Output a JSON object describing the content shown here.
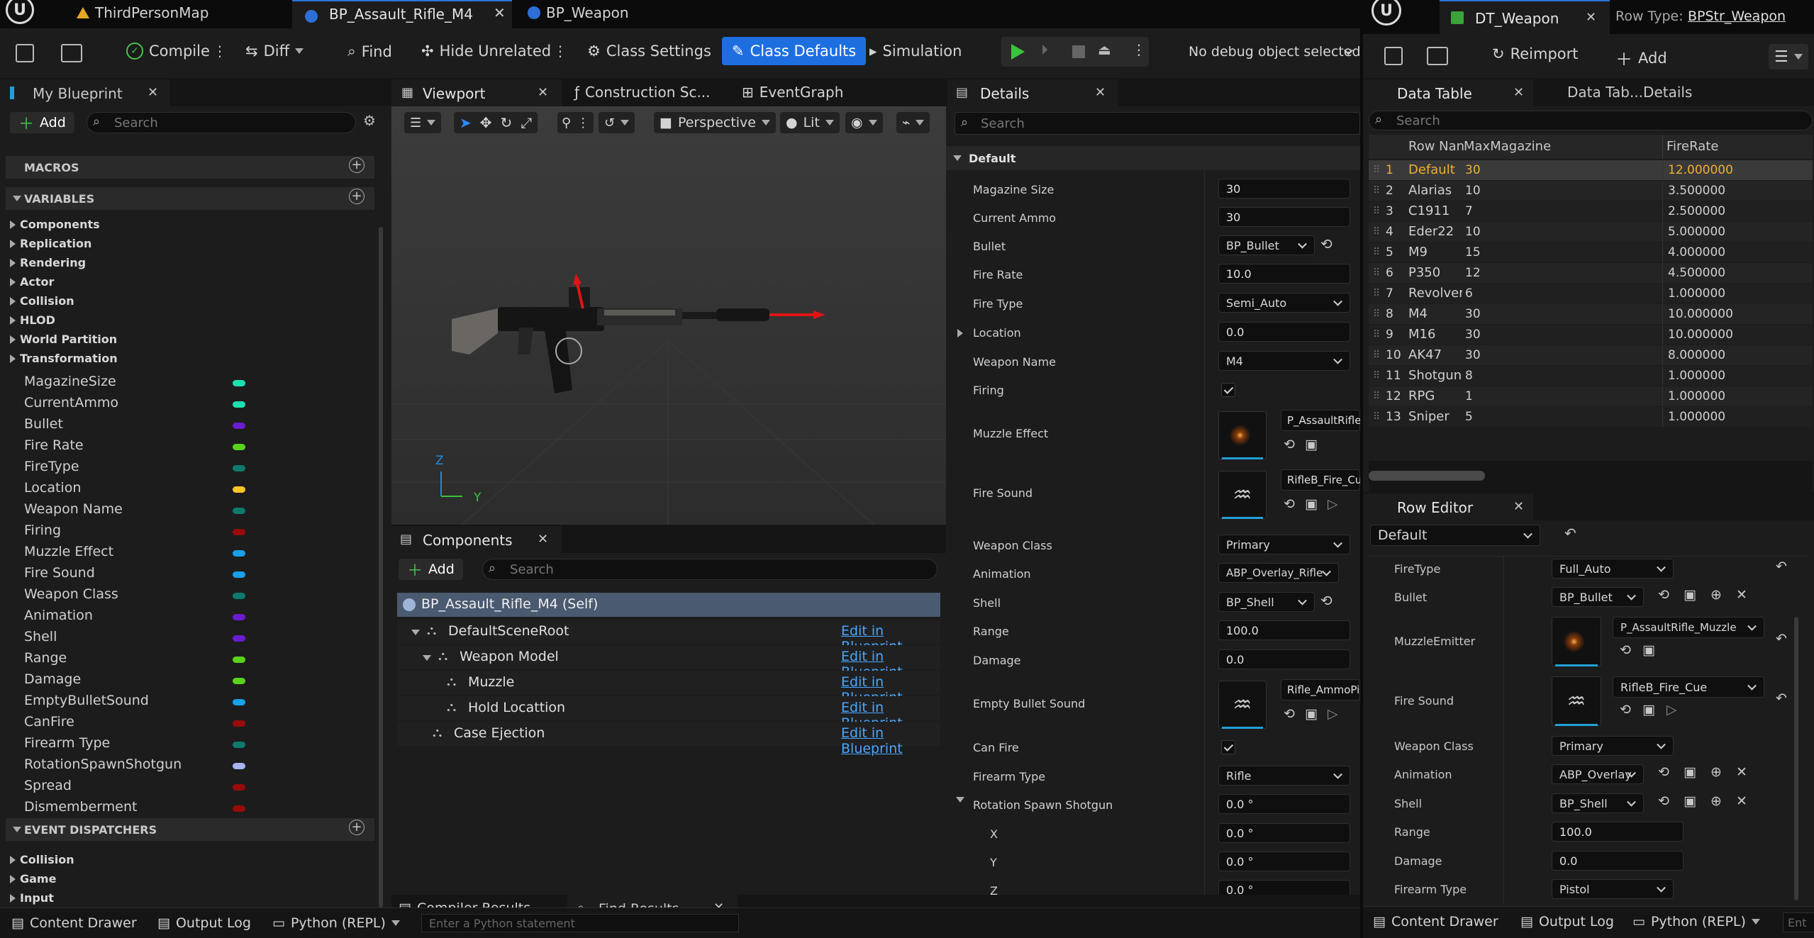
{
  "tabs": {
    "map": "ThirdPersonMap",
    "rifle": "BP_Assault_Rifle_M4",
    "weapon": "BP_Weapon",
    "dt": "DT_Weapon",
    "row_type_label": "Row Type:",
    "row_type_value": "BPStr_Weapon"
  },
  "toolbar": {
    "compile": "Compile",
    "diff": "Diff",
    "find": "Find",
    "hide_unrelated": "Hide Unrelated",
    "class_settings": "Class Settings",
    "class_defaults": "Class Defaults",
    "simulation": "Simulation",
    "debug": "No debug object selected",
    "reimport": "Reimport",
    "add": "Add"
  },
  "my_blueprint": {
    "title": "My Blueprint",
    "add": "Add",
    "search_placeholder": "Search",
    "macros": "MACROS",
    "variables": "VARIABLES",
    "categories": [
      "Components",
      "Replication",
      "Rendering",
      "Actor",
      "Collision",
      "HLOD",
      "World Partition",
      "Transformation"
    ],
    "vars": [
      {
        "name": "MagazineSize",
        "color": "#1de0b0"
      },
      {
        "name": "CurrentAmmo",
        "color": "#1de0b0"
      },
      {
        "name": "Bullet",
        "color": "#6a1cd0"
      },
      {
        "name": "Fire Rate",
        "color": "#5ad21a"
      },
      {
        "name": "FireType",
        "color": "#0d7a6c"
      },
      {
        "name": "Location",
        "color": "#f6c62a"
      },
      {
        "name": "Weapon Name",
        "color": "#0d7a6c"
      },
      {
        "name": "Firing",
        "color": "#9a0a0a"
      },
      {
        "name": "Muzzle Effect",
        "color": "#18a0e8"
      },
      {
        "name": "Fire Sound",
        "color": "#18a0e8"
      },
      {
        "name": "Weapon Class",
        "color": "#0d7a6c"
      },
      {
        "name": "Animation",
        "color": "#6a1cd0"
      },
      {
        "name": "Shell",
        "color": "#6a1cd0"
      },
      {
        "name": "Range",
        "color": "#5ad21a"
      },
      {
        "name": "Damage",
        "color": "#5ad21a"
      },
      {
        "name": "EmptyBulletSound",
        "color": "#18a0e8"
      },
      {
        "name": "CanFire",
        "color": "#9a0a0a"
      },
      {
        "name": "Firearm Type",
        "color": "#0d7a6c"
      },
      {
        "name": "RotationSpawnShotgun",
        "color": "#a8b4f0"
      },
      {
        "name": "Spread",
        "color": "#9a0a0a"
      },
      {
        "name": "Dismemberment",
        "color": "#9a0a0a"
      }
    ],
    "event_dispatchers": "EVENT DISPATCHERS",
    "ed_categories": [
      "Collision",
      "Game",
      "Input"
    ]
  },
  "viewport": {
    "tab_viewport": "Viewport",
    "tab_construction": "Construction Sc...",
    "tab_eventgraph": "EventGraph",
    "perspective": "Perspective",
    "lit": "Lit",
    "axis_z": "Z",
    "axis_y": "Y"
  },
  "components": {
    "title": "Components",
    "add": "Add",
    "search_placeholder": "Search",
    "self": "BP_Assault_Rifle_M4 (Self)",
    "edit": "Edit in Blueprint",
    "items": [
      "DefaultSceneRoot",
      "Weapon Model",
      "Muzzle",
      "Hold Locattion",
      "Case Ejection"
    ]
  },
  "details": {
    "title": "Details",
    "search_placeholder": "Search",
    "section": "Default",
    "props": {
      "magazine_size": {
        "label": "Magazine Size",
        "value": "30"
      },
      "current_ammo": {
        "label": "Current Ammo",
        "value": "30"
      },
      "bullet": {
        "label": "Bullet",
        "value": "BP_Bullet"
      },
      "fire_rate": {
        "label": "Fire Rate",
        "value": "10.0"
      },
      "fire_type": {
        "label": "Fire Type",
        "value": "Semi_Auto"
      },
      "location": {
        "label": "Location",
        "value": "0.0"
      },
      "weapon_name": {
        "label": "Weapon Name",
        "value": "M4"
      },
      "firing": {
        "label": "Firing"
      },
      "muzzle_effect": {
        "label": "Muzzle Effect",
        "value": "P_AssaultRifle"
      },
      "fire_sound": {
        "label": "Fire Sound",
        "value": "RifleB_Fire_Cu"
      },
      "weapon_class": {
        "label": "Weapon Class",
        "value": "Primary"
      },
      "animation": {
        "label": "Animation",
        "value": "ABP_Overlay_Rifle"
      },
      "shell": {
        "label": "Shell",
        "value": "BP_Shell"
      },
      "range": {
        "label": "Range",
        "value": "100.0"
      },
      "damage": {
        "label": "Damage",
        "value": "0.0"
      },
      "empty_bullet_sound": {
        "label": "Empty Bullet Sound",
        "value": "Rifle_AmmoPi"
      },
      "can_fire": {
        "label": "Can Fire"
      },
      "firearm_type": {
        "label": "Firearm Type",
        "value": "Rifle"
      },
      "rotation_spawn": {
        "label": "Rotation Spawn Shotgun",
        "value": "0.0 °"
      },
      "x": {
        "label": "X",
        "value": "0.0 °"
      },
      "y": {
        "label": "Y",
        "value": "0.0 °"
      },
      "z": {
        "label": "Z",
        "value": "0.0 °"
      }
    }
  },
  "data_table": {
    "tab1": "Data Table",
    "tab2": "Data Tab...Details",
    "search_placeholder": "Search",
    "columns": [
      "Row Nan",
      "MaxMagazine",
      "FireRate"
    ],
    "rows": [
      [
        "1",
        "Default",
        "30",
        "12.000000"
      ],
      [
        "2",
        "Alarias",
        "10",
        "3.500000"
      ],
      [
        "3",
        "C1911",
        "7",
        "2.500000"
      ],
      [
        "4",
        "Eder22",
        "10",
        "5.000000"
      ],
      [
        "5",
        "M9",
        "15",
        "4.000000"
      ],
      [
        "6",
        "P350",
        "12",
        "4.500000"
      ],
      [
        "7",
        "Revolver",
        "6",
        "1.000000"
      ],
      [
        "8",
        "M4",
        "30",
        "10.000000"
      ],
      [
        "9",
        "M16",
        "30",
        "10.000000"
      ],
      [
        "10",
        "AK47",
        "30",
        "8.000000"
      ],
      [
        "11",
        "Shotgun",
        "8",
        "1.000000"
      ],
      [
        "12",
        "RPG",
        "1",
        "1.000000"
      ],
      [
        "13",
        "Sniper",
        "5",
        "1.000000"
      ]
    ]
  },
  "row_editor": {
    "title": "Row Editor",
    "row": "Default",
    "fields": {
      "fire_type": {
        "label": "FireType",
        "value": "Full_Auto"
      },
      "bullet": {
        "label": "Bullet",
        "value": "BP_Bullet"
      },
      "muzzle": {
        "label": "MuzzleEmitter",
        "value": "P_AssaultRifle_Muzzle"
      },
      "fire_sound": {
        "label": "Fire Sound",
        "value": "RifleB_Fire_Cue"
      },
      "weapon_class": {
        "label": "Weapon Class",
        "value": "Primary"
      },
      "animation": {
        "label": "Animation",
        "value": "ABP_Overlay"
      },
      "shell": {
        "label": "Shell",
        "value": "BP_Shell"
      },
      "range": {
        "label": "Range",
        "value": "100.0"
      },
      "damage": {
        "label": "Damage",
        "value": "0.0"
      },
      "firearm_type": {
        "label": "Firearm Type",
        "value": "Pistol"
      }
    }
  },
  "bottom": {
    "content_drawer": "Content Drawer",
    "output_log": "Output Log",
    "python": "Python (REPL)",
    "cmd_placeholder": "Enter a Python statement",
    "compiler_results": "Compiler Results",
    "find_results": "Find Results",
    "ent": "Ent"
  }
}
